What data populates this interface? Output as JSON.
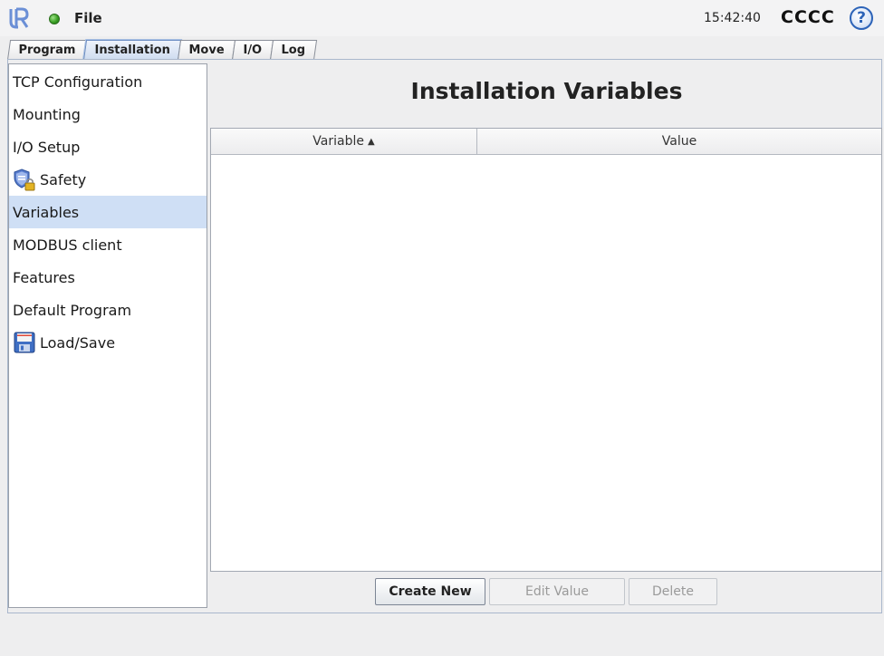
{
  "topbar": {
    "file_label": "File",
    "time": "15:42:40",
    "robot_name": "CCCC",
    "help_symbol": "?"
  },
  "tabs": [
    {
      "label": "Program",
      "active": false
    },
    {
      "label": "Installation",
      "active": true
    },
    {
      "label": "Move",
      "active": false
    },
    {
      "label": "I/O",
      "active": false
    },
    {
      "label": "Log",
      "active": false
    }
  ],
  "sidebar": {
    "items": [
      {
        "label": "TCP Configuration",
        "icon": null
      },
      {
        "label": "Mounting",
        "icon": null
      },
      {
        "label": "I/O Setup",
        "icon": null
      },
      {
        "label": "Safety",
        "icon": "safety-shield-lock-icon"
      },
      {
        "label": "Variables",
        "icon": null,
        "selected": true
      },
      {
        "label": "MODBUS client",
        "icon": null
      },
      {
        "label": "Features",
        "icon": null
      },
      {
        "label": "Default Program",
        "icon": null
      },
      {
        "label": "Load/Save",
        "icon": "floppy-disk-icon"
      }
    ]
  },
  "main": {
    "title": "Installation Variables",
    "table": {
      "columns": [
        "Variable",
        "Value"
      ],
      "sort_indicator": "▲",
      "rows": []
    },
    "buttons": {
      "create_new": "Create New",
      "edit_value": "Edit Value",
      "delete": "Delete"
    }
  },
  "colors": {
    "selected_row": "#cfdff5",
    "status_led": "#3aa024",
    "help_blue": "#2c63b8"
  }
}
